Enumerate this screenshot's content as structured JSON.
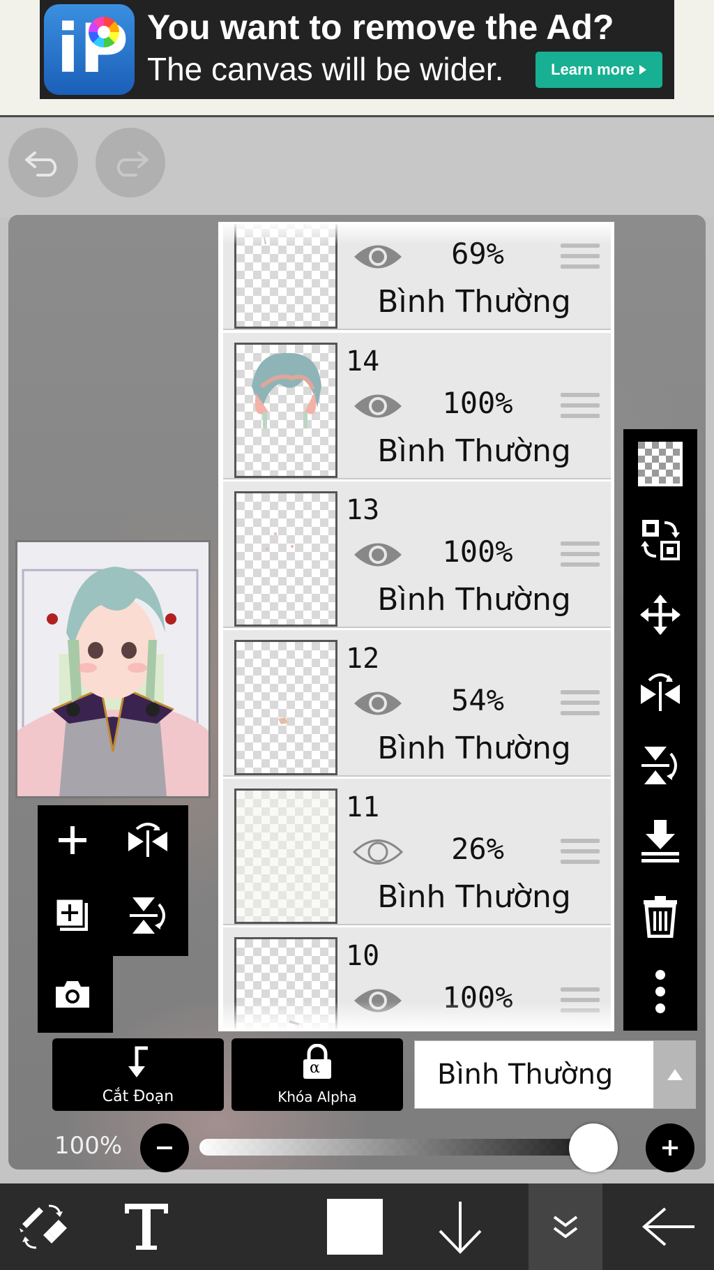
{
  "ad": {
    "title": "You want to remove the Ad?",
    "subtitle": "The canvas will be wider.",
    "learn_more": "Learn more",
    "logo_letters": "iP",
    "logo_icon": "ibispaint-logo"
  },
  "toolbar_top": {
    "undo_icon": "undo-icon",
    "redo_icon": "redo-icon"
  },
  "layers": [
    {
      "number": "",
      "opacity": "69%",
      "blend": "Bình Thường",
      "visible": true,
      "thumb": "sparse"
    },
    {
      "number": "14",
      "opacity": "100%",
      "blend": "Bình Thường",
      "visible": true,
      "thumb": "hair"
    },
    {
      "number": "13",
      "opacity": "100%",
      "blend": "Bình Thường",
      "visible": true,
      "thumb": "dots"
    },
    {
      "number": "12",
      "opacity": "54%",
      "blend": "Bình Thường",
      "visible": true,
      "thumb": "dot"
    },
    {
      "number": "11",
      "opacity": "26%",
      "blend": "Bình Thường",
      "visible": false,
      "thumb": "empty"
    },
    {
      "number": "10",
      "opacity": "100%",
      "blend": "Bình Thường",
      "visible": true,
      "thumb": "line"
    }
  ],
  "left_tools": [
    "add-layer-icon",
    "flip-horizontal-icon",
    "add-copy-layer-icon",
    "flip-vertical-icon",
    "camera-icon"
  ],
  "right_tools": [
    "transparent-fill-icon",
    "layer-swap-icon",
    "move-icon",
    "flip-horizontal-icon",
    "flip-vertical-icon",
    "merge-down-icon",
    "trash-icon",
    "more-icon"
  ],
  "bottom": {
    "clip_label": "Cắt Đoạn",
    "alpha_lock_label": "Khóa Alpha",
    "alpha_symbol": "α",
    "blend_mode": "Bình Thường",
    "opacity_label": "100%",
    "opacity_value": 1.0
  },
  "bottom_toolbar": [
    "brush-eraser-toggle-icon",
    "text-tool-icon",
    "color-swatch",
    "arrow-down-icon",
    "collapse-icon",
    "back-arrow-icon"
  ],
  "colors": {
    "ad_button": "#17b092",
    "panel_bg": "#e8e8e8",
    "toolbar_bg": "#2b2b2b"
  }
}
